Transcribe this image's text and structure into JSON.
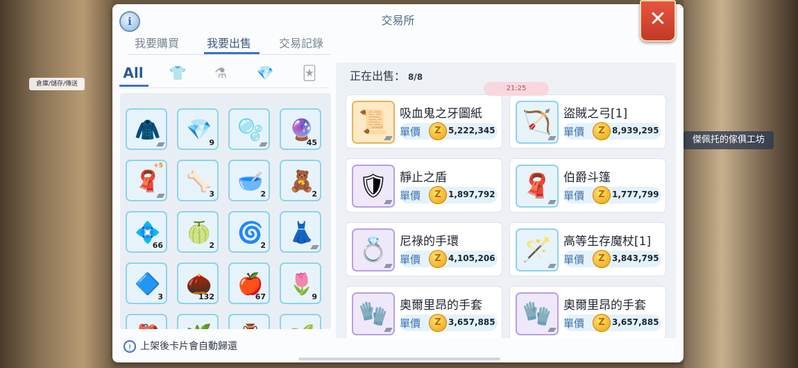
{
  "window": {
    "title": "交易所",
    "info_icon": "i",
    "close_icon": "✕"
  },
  "tabs": [
    {
      "label": "我要購買"
    },
    {
      "label": "我要出售"
    },
    {
      "label": "交易記錄"
    }
  ],
  "active_tab": "我要出售",
  "categories": [
    {
      "label": "All",
      "icon": "all-text"
    },
    {
      "label": "",
      "icon": "armor-icon"
    },
    {
      "label": "",
      "icon": "potion-icon"
    },
    {
      "label": "",
      "icon": "gem-icon"
    },
    {
      "label": "",
      "icon": "card-icon"
    }
  ],
  "inventory": [
    {
      "icon": "purple-robe-icon",
      "glyph": "🧥",
      "qty": ""
    },
    {
      "icon": "blue-crystal-icon",
      "glyph": "💎",
      "qty": "9"
    },
    {
      "icon": "pink-bubbles-icon",
      "glyph": "🫧",
      "qty": ""
    },
    {
      "icon": "purple-orb-icon",
      "glyph": "🔮",
      "qty": "45"
    },
    {
      "icon": "red-cape-icon",
      "glyph": "🧣",
      "qty": "",
      "refine": "+5"
    },
    {
      "icon": "bone-icon",
      "glyph": "🦴",
      "qty": "3"
    },
    {
      "icon": "mortar-icon",
      "glyph": "🥣",
      "qty": "2"
    },
    {
      "icon": "spirit-figure-icon",
      "glyph": "🧸",
      "qty": "2"
    },
    {
      "icon": "ice-crystal-icon",
      "glyph": "💠",
      "qty": "66"
    },
    {
      "icon": "lime-fruit-icon",
      "glyph": "🍈",
      "qty": "2"
    },
    {
      "icon": "horn-icon",
      "glyph": "🌀",
      "qty": "2"
    },
    {
      "icon": "blue-dress-icon",
      "glyph": "👗",
      "qty": ""
    },
    {
      "icon": "blue-shard-icon",
      "glyph": "🔷",
      "qty": "3"
    },
    {
      "icon": "seed-pod-icon",
      "glyph": "🌰",
      "qty": "132"
    },
    {
      "icon": "red-apple-juice-icon",
      "glyph": "🍎",
      "qty": "67"
    },
    {
      "icon": "pink-bud-icon",
      "glyph": "🌷",
      "qty": "9"
    },
    {
      "icon": "red-bag-icon",
      "glyph": "🎒",
      "qty": ""
    },
    {
      "icon": "herb-icon",
      "glyph": "🌿",
      "qty": ""
    },
    {
      "icon": "golden-vase-icon",
      "glyph": "🏺",
      "qty": ""
    },
    {
      "icon": "sprout-icon",
      "glyph": "🌱",
      "qty": ""
    }
  ],
  "notice": {
    "icon": "!",
    "text": "上架後卡片會自動歸還"
  },
  "listings_header": {
    "label": "正在出售：",
    "count": "8/8"
  },
  "clock": "21:25",
  "listings": [
    {
      "name": "吸血鬼之牙圖紙",
      "unit_label": "單價",
      "coin": "Z",
      "price": "5,222,345",
      "icon": "blueprint-icon",
      "glyph": "📜",
      "frame": "gold"
    },
    {
      "name": "盜賊之弓[1]",
      "unit_label": "單價",
      "coin": "Z",
      "price": "8,939,295",
      "icon": "bow-icon",
      "glyph": "🏹",
      "frame": "blue"
    },
    {
      "name": "靜止之盾",
      "unit_label": "單價",
      "coin": "Z",
      "price": "1,897,792",
      "icon": "shield-icon",
      "glyph": "🛡",
      "frame": "purple"
    },
    {
      "name": "伯爵斗篷",
      "unit_label": "單價",
      "coin": "Z",
      "price": "1,777,799",
      "icon": "cape-icon",
      "glyph": "🧣",
      "frame": "blue"
    },
    {
      "name": "尼祿的手環",
      "unit_label": "單價",
      "coin": "Z",
      "price": "4,105,206",
      "icon": "bracelet-icon",
      "glyph": "💍",
      "frame": "purple"
    },
    {
      "name": "高等生存魔杖[1]",
      "unit_label": "單價",
      "coin": "Z",
      "price": "3,843,795",
      "icon": "staff-icon",
      "glyph": "🪄",
      "frame": "blue"
    },
    {
      "name": "奧爾里昂的手套",
      "unit_label": "單價",
      "coin": "Z",
      "price": "3,657,885",
      "icon": "glove-icon",
      "glyph": "🧤",
      "frame": "purple"
    },
    {
      "name": "奧爾里昂的手套",
      "unit_label": "單價",
      "coin": "Z",
      "price": "3,657,885",
      "icon": "glove-icon",
      "glyph": "🧤",
      "frame": "purple"
    }
  ],
  "background": {
    "left_bubble": "倉庫/儲存/傳送",
    "right_label": "傑佩托的傢俱工坊"
  }
}
